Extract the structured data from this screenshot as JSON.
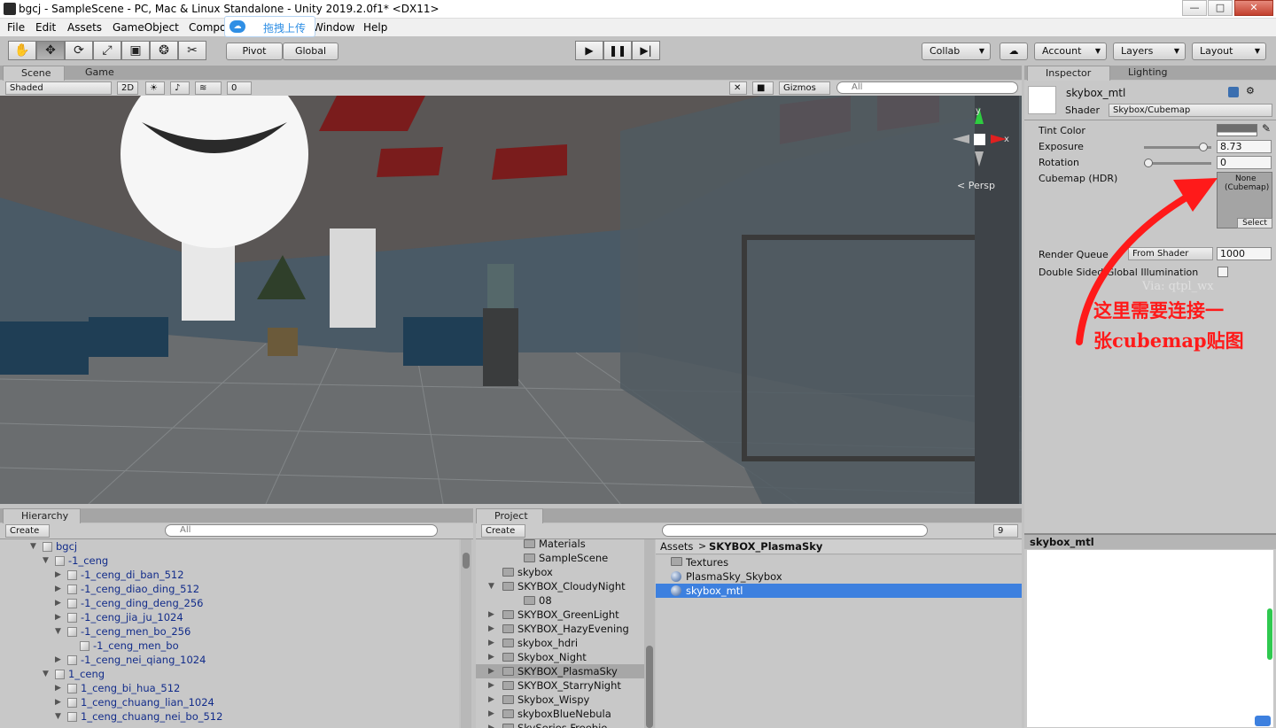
{
  "window": {
    "title": "bgcj - SampleScene - PC, Mac & Linux Standalone - Unity 2019.2.0f1* <DX11>",
    "min": "—",
    "max": "□",
    "close": "✕"
  },
  "menu": [
    "File",
    "Edit",
    "Assets",
    "GameObject",
    "Compo",
    "Window",
    "Help"
  ],
  "upload_badge": {
    "label": "拖拽上传"
  },
  "toolbar": {
    "tools": [
      "✋",
      "✥",
      "⟳",
      "⤢",
      "▣",
      "❂",
      "✂"
    ],
    "pivot": "Pivot",
    "global": "Global",
    "play": "▶",
    "pause": "❚❚",
    "step": "▶|",
    "collab": "Collab",
    "account": "Account",
    "layers": "Layers",
    "layout": "Layout"
  },
  "scene": {
    "tabs": [
      "Scene",
      "Game"
    ],
    "shading": "Shaded",
    "mode_2d": "2D",
    "hidden_count": "0",
    "gizmos": "Gizmos",
    "search_placeholder": "All",
    "persp": "Persp",
    "axis_y": "y",
    "axis_x": "x"
  },
  "hierarchy": {
    "tab": "Hierarchy",
    "create": "Create",
    "search_placeholder": "All",
    "items": [
      {
        "label": "bgcj",
        "depth": 0,
        "state": "open"
      },
      {
        "label": "-1_ceng",
        "depth": 1,
        "state": "open"
      },
      {
        "label": "-1_ceng_di_ban_512",
        "depth": 2,
        "state": "closed"
      },
      {
        "label": "-1_ceng_diao_ding_512",
        "depth": 2,
        "state": "closed"
      },
      {
        "label": "-1_ceng_ding_deng_256",
        "depth": 2,
        "state": "closed"
      },
      {
        "label": "-1_ceng_jia_ju_1024",
        "depth": 2,
        "state": "closed"
      },
      {
        "label": "-1_ceng_men_bo_256",
        "depth": 2,
        "state": "open"
      },
      {
        "label": "-1_ceng_men_bo",
        "depth": 3,
        "state": "none"
      },
      {
        "label": "-1_ceng_nei_qiang_1024",
        "depth": 2,
        "state": "closed"
      },
      {
        "label": "1_ceng",
        "depth": 1,
        "state": "open"
      },
      {
        "label": "1_ceng_bi_hua_512",
        "depth": 2,
        "state": "closed"
      },
      {
        "label": "1_ceng_chuang_lian_1024",
        "depth": 2,
        "state": "closed"
      },
      {
        "label": "1_ceng_chuang_nei_bo_512",
        "depth": 2,
        "state": "open"
      }
    ]
  },
  "project": {
    "tab": "Project",
    "create": "Create",
    "search_placeholder": "",
    "filter_count": "9",
    "folders": [
      {
        "label": "Materials",
        "depth": 2,
        "state": "none"
      },
      {
        "label": "SampleScene",
        "depth": 2,
        "state": "none"
      },
      {
        "label": "skybox",
        "depth": 1,
        "state": "none"
      },
      {
        "label": "SKYBOX_CloudyNight",
        "depth": 1,
        "state": "open"
      },
      {
        "label": "08",
        "depth": 2,
        "state": "none"
      },
      {
        "label": "SKYBOX_GreenLight",
        "depth": 1,
        "state": "closed"
      },
      {
        "label": "SKYBOX_HazyEvening",
        "depth": 1,
        "state": "closed"
      },
      {
        "label": "skybox_hdri",
        "depth": 1,
        "state": "closed"
      },
      {
        "label": "Skybox_Night",
        "depth": 1,
        "state": "closed"
      },
      {
        "label": "SKYBOX_PlasmaSky",
        "depth": 1,
        "state": "closed",
        "selected": true
      },
      {
        "label": "SKYBOX_StarryNight",
        "depth": 1,
        "state": "closed"
      },
      {
        "label": "Skybox_Wispy",
        "depth": 1,
        "state": "closed"
      },
      {
        "label": "skyboxBlueNebula",
        "depth": 1,
        "state": "closed"
      },
      {
        "label": "SkySeries Freebie",
        "depth": 1,
        "state": "closed"
      }
    ],
    "breadcrumb": {
      "root": "Assets",
      "current": "SKYBOX_PlasmaSky"
    },
    "assets": [
      {
        "label": "Textures",
        "kind": "folder"
      },
      {
        "label": "PlasmaSky_Skybox",
        "kind": "material"
      },
      {
        "label": "skybox_mtl",
        "kind": "material",
        "selected": true
      }
    ]
  },
  "inspector": {
    "tabs": [
      "Inspector",
      "Lighting"
    ],
    "material_name": "skybox_mtl",
    "shader_label": "Shader",
    "shader_value": "Skybox/Cubemap",
    "tint_label": "Tint Color",
    "exposure_label": "Exposure",
    "exposure_value": "8.73",
    "exposure_level": 0.94,
    "rotation_label": "Rotation",
    "rotation_value": "0",
    "rotation_level": 0.0,
    "cubemap_label": "Cubemap   (HDR)",
    "cubemap_none": "None",
    "cubemap_type": "(Cubemap)",
    "cubemap_select": "Select",
    "render_queue_label": "Render Queue",
    "render_queue_mode": "From Shader",
    "render_queue_value": "1000",
    "dsgi_label": "Double Sided Global Illumination",
    "watermark": "Via: qtpl_wx",
    "annotation_line1": "这里需要连接一",
    "annotation_line2": "张cubemap贴图"
  },
  "preview": {
    "title": "skybox_mtl"
  },
  "colors": {
    "selection": "#3d80df",
    "annotation": "#ff1a1a",
    "link_blue": "#122c8a"
  }
}
